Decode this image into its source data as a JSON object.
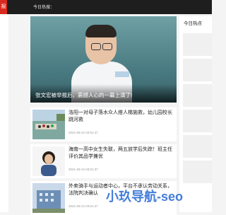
{
  "header": {
    "logo_text": "报",
    "hot_label": "今日热搜："
  },
  "hero": {
    "caption": "张文宏被举报后，震撼人心的一幕上演了!",
    "dots": 2
  },
  "news": [
    {
      "title": "洛阳一对母子落水众人搭人梯施救，幼儿园校长跳河救",
      "date": "2021-06-24 03:51:47",
      "thumb": "river-scene"
    },
    {
      "title": "海南一高中女生失联，两五放学后失踪！班主任评价其品学兼优",
      "date": "2021-06-24 03:51:37",
      "thumb": "student-photo"
    },
    {
      "title": "外卖骑手与运动者中心，平台不承认劳动关系，法院判决确认",
      "date": "2021-06-24 03:51:27",
      "thumb": "building-photo"
    }
  ],
  "sidebar": {
    "title": "今日热点"
  },
  "watermark": "小玖导航-seo"
}
